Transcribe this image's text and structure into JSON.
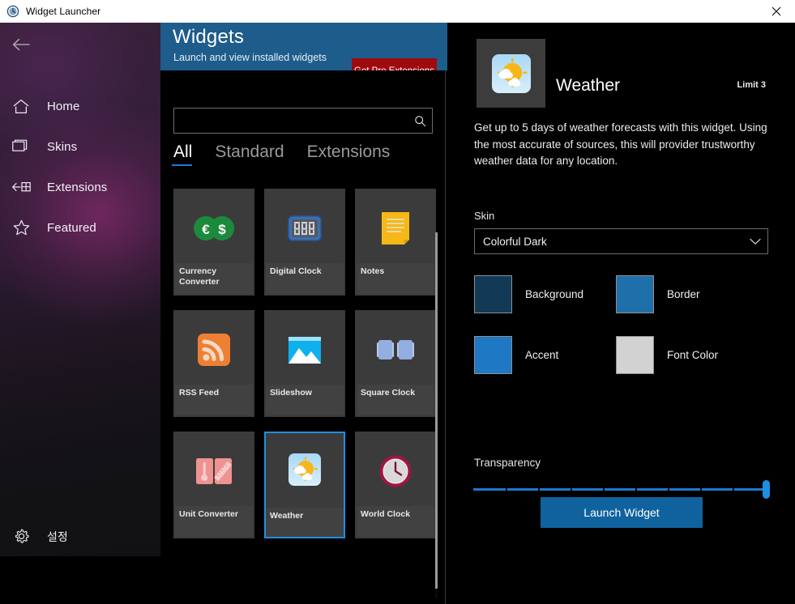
{
  "titlebar": {
    "title": "Widget Launcher",
    "icon": "clock-app-icon",
    "close_label": "✕"
  },
  "sidebar": {
    "back_label": "←",
    "items": [
      {
        "label": "Home",
        "icon": "home-icon"
      },
      {
        "label": "Skins",
        "icon": "window-stack-icon"
      },
      {
        "label": "Extensions",
        "icon": "extensions-icon"
      },
      {
        "label": "Featured",
        "icon": "star-icon"
      }
    ],
    "settings": {
      "label": "설정",
      "icon": "gear-icon"
    }
  },
  "header": {
    "title": "Widgets",
    "subtitle": "Launch and view installed widgets",
    "pro_button": "Get Pro Extensions",
    "background_color": "#1e5c8c",
    "pro_button_color": "#9e0a0d"
  },
  "catalog": {
    "search": {
      "value": "",
      "placeholder": "",
      "icon": "search-icon"
    },
    "tabs": [
      {
        "label": "All",
        "active": true
      },
      {
        "label": "Standard",
        "active": false
      },
      {
        "label": "Extensions",
        "active": false
      }
    ],
    "accent_color": "#1f78d1",
    "tiles": [
      {
        "name": "Currency Converter",
        "icon": "currency-coins-icon",
        "selected": false
      },
      {
        "name": "Digital Clock",
        "icon": "digital-clock-icon",
        "selected": false
      },
      {
        "name": "Notes",
        "icon": "notes-icon",
        "selected": false
      },
      {
        "name": "RSS Feed",
        "icon": "rss-icon",
        "selected": false
      },
      {
        "name": "Slideshow",
        "icon": "picture-icon",
        "selected": false
      },
      {
        "name": "Square Clock",
        "icon": "square-clock-icon",
        "selected": false
      },
      {
        "name": "Unit Converter",
        "icon": "unit-converter-icon",
        "selected": false
      },
      {
        "name": "Weather",
        "icon": "weather-sun-cloud-icon",
        "selected": true
      },
      {
        "name": "World Clock",
        "icon": "world-clock-icon",
        "selected": false
      }
    ]
  },
  "detail": {
    "icon": "weather-sun-cloud-icon",
    "title": "Weather",
    "limit": "Limit 3",
    "description": "Get up to 5 days of weather forecasts with this widget. Using the most accurate of sources, this will provider trustworthy weather data for any location.",
    "skin_label": "Skin",
    "skin_value": "Colorful Dark",
    "skin_caret": "chevron-down-icon",
    "swatches": [
      {
        "name": "Background",
        "color": "#123a57"
      },
      {
        "name": "Border",
        "color": "#1f6fab"
      },
      {
        "name": "Accent",
        "color": "#1f78c4"
      },
      {
        "name": "Font Color",
        "color": "#d2d2d2"
      }
    ],
    "transparency_label": "Transparency",
    "transparency_value": 100,
    "transparency_ticks": 9,
    "launch_button": "Launch Widget",
    "launch_button_color": "#10629f"
  }
}
